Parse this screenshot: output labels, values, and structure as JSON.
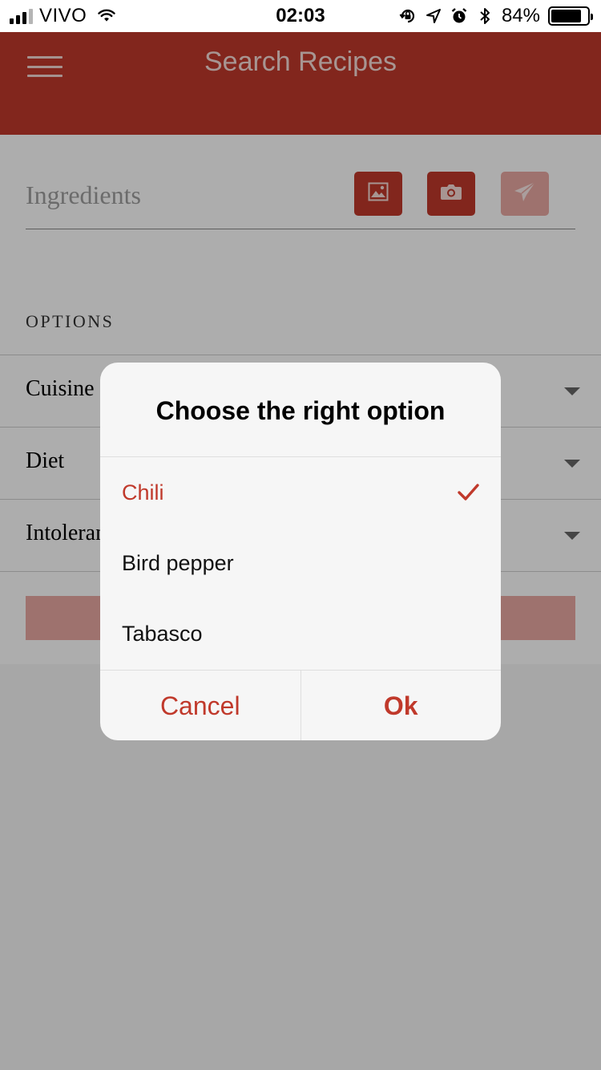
{
  "status_bar": {
    "carrier": "VIVO",
    "time": "02:03",
    "battery_percent": "84%",
    "battery_level": 0.84,
    "signal_bars_filled": 3,
    "signal_bars_total": 4,
    "icons": [
      "signal-icon",
      "wifi-icon",
      "orientation-lock-icon",
      "location-arrow-icon",
      "alarm-icon",
      "bluetooth-icon",
      "battery-icon"
    ]
  },
  "header": {
    "title": "Search Recipes",
    "menu_icon": "hamburger-menu-icon"
  },
  "search": {
    "placeholder": "Ingredients",
    "value": "",
    "buttons": [
      {
        "name": "gallery-button",
        "icon": "image-icon",
        "enabled": true
      },
      {
        "name": "camera-button",
        "icon": "camera-icon",
        "enabled": true
      },
      {
        "name": "send-button",
        "icon": "paper-plane-icon",
        "enabled": false
      }
    ]
  },
  "options": {
    "heading": "OPTIONS",
    "items": [
      {
        "label": "Cuisine"
      },
      {
        "label": "Diet"
      },
      {
        "label": "Intolerances"
      }
    ]
  },
  "dialog": {
    "title": "Choose the right option",
    "choices": [
      {
        "label": "Chili",
        "selected": true
      },
      {
        "label": "Bird pepper",
        "selected": false
      },
      {
        "label": "Tabasco",
        "selected": false
      }
    ],
    "cancel_label": "Cancel",
    "ok_label": "Ok"
  },
  "colors": {
    "accent": "#c0392b",
    "accent_disabled": "#e9a8a2",
    "overlay": "rgba(0,0,0,0.32)"
  }
}
